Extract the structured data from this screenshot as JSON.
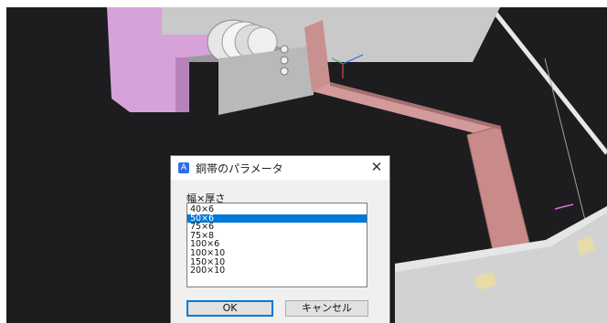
{
  "colors": {
    "viewport_bg": "#1d1d1f",
    "pink_part": "#d6a0d8",
    "copper_strap": "#c98a8a",
    "gray_block": "#cfcfcf",
    "selection": "#0078d7"
  },
  "dialog": {
    "icon": "app-icon",
    "title": "銅帯のパラメータ",
    "close_glyph": "✕",
    "list_label": "幅×厚さ",
    "items": [
      "40×6",
      "50×6",
      "75×6",
      "75×8",
      "100×6",
      "100×10",
      "150×10",
      "200×10"
    ],
    "selected_index": 1,
    "ok_label": "OK",
    "cancel_label": "キャンセル"
  }
}
